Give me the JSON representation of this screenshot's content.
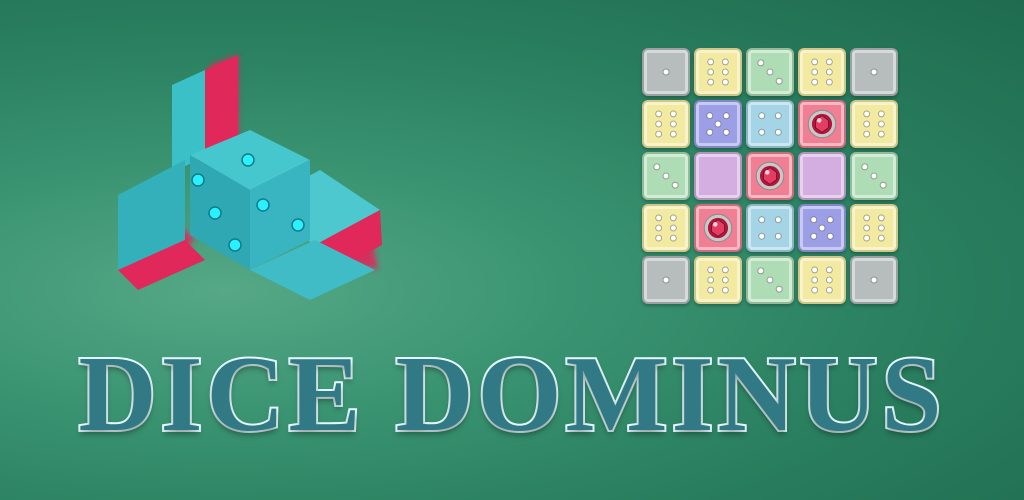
{
  "title": "DICE DOMINUS",
  "colors": {
    "grey": "#b7bcbd",
    "yellow": "#f2eaa0",
    "green": "#aedcb4",
    "blue": "#a5d4e6",
    "purple": "#9c9fe6",
    "violet": "#d4aee0",
    "pink": "#f07f94",
    "cyan": "#2fb4c2",
    "magenta": "#e0285a"
  },
  "board": {
    "rows": [
      [
        {
          "color": "grey",
          "pips": 1
        },
        {
          "color": "yellow",
          "pips": 6
        },
        {
          "color": "green",
          "pips": 3
        },
        {
          "color": "yellow",
          "pips": 6
        },
        {
          "color": "grey",
          "pips": 1
        }
      ],
      [
        {
          "color": "yellow",
          "pips": 6
        },
        {
          "color": "purple",
          "pips": 5
        },
        {
          "color": "blue",
          "pips": 4
        },
        {
          "color": "pink",
          "pips": 0,
          "gem": true
        },
        {
          "color": "yellow",
          "pips": 6
        }
      ],
      [
        {
          "color": "green",
          "pips": 3
        },
        {
          "color": "violet",
          "pips": 0
        },
        {
          "color": "pink",
          "pips": 0,
          "gem": true
        },
        {
          "color": "violet",
          "pips": 0
        },
        {
          "color": "green",
          "pips": 3
        }
      ],
      [
        {
          "color": "yellow",
          "pips": 6
        },
        {
          "color": "pink",
          "pips": 0,
          "gem": true
        },
        {
          "color": "blue",
          "pips": 4
        },
        {
          "color": "purple",
          "pips": 5
        },
        {
          "color": "yellow",
          "pips": 6
        }
      ],
      [
        {
          "color": "grey",
          "pips": 1
        },
        {
          "color": "yellow",
          "pips": 6
        },
        {
          "color": "green",
          "pips": 3
        },
        {
          "color": "yellow",
          "pips": 6
        },
        {
          "color": "grey",
          "pips": 1
        }
      ]
    ]
  }
}
